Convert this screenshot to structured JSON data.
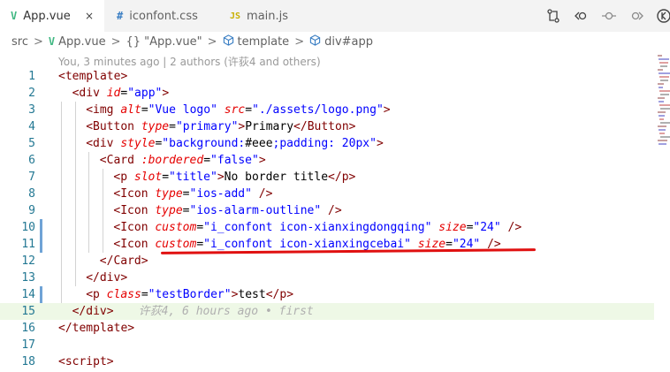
{
  "tabs": [
    {
      "icon": "V",
      "label": "App.vue",
      "active": true
    },
    {
      "icon": "#",
      "label": "iconfont.css",
      "active": false
    },
    {
      "icon": "JS",
      "label": "main.js",
      "active": false
    }
  ],
  "tab_close": "×",
  "breadcrumb": {
    "parts": [
      "src",
      "App.vue",
      "{} \"App.vue\"",
      "template",
      "div#app"
    ],
    "separator": ">"
  },
  "codelens": "You, 3 minutes ago | 2 authors (许荻4 and others)",
  "blame": "许荻4, 6 hours ago • first",
  "colors": {
    "vue_green": "#41b883",
    "css_hash": "#3b7fc4",
    "js_yellow": "#c9b000",
    "tag": "#800000",
    "attr": "#e50000",
    "string": "#0000ff",
    "annotation_red": "#e01010",
    "line_highlight": "#eef8e6"
  },
  "lines": [
    {
      "n": "1",
      "tokens": [
        [
          "pun",
          "<"
        ],
        [
          "tag",
          "template"
        ],
        [
          "pun",
          ">"
        ]
      ]
    },
    {
      "n": "2",
      "tokens": [
        [
          "pun",
          "<"
        ],
        [
          "tag",
          "div"
        ],
        [
          "txt",
          " "
        ],
        [
          "attr-i",
          "id"
        ],
        [
          "txt",
          "="
        ],
        [
          "str",
          "\"app\""
        ],
        [
          "pun",
          ">"
        ]
      ]
    },
    {
      "n": "3",
      "tokens": [
        [
          "pun",
          "<"
        ],
        [
          "tag",
          "img"
        ],
        [
          "txt",
          " "
        ],
        [
          "attr-i",
          "alt"
        ],
        [
          "txt",
          "="
        ],
        [
          "str",
          "\"Vue logo\""
        ],
        [
          "txt",
          " "
        ],
        [
          "attr-i",
          "src"
        ],
        [
          "txt",
          "="
        ],
        [
          "str",
          "\"./assets/logo.png\""
        ],
        [
          "pun",
          ">"
        ]
      ]
    },
    {
      "n": "4",
      "tokens": [
        [
          "pun",
          "<"
        ],
        [
          "tag",
          "Button"
        ],
        [
          "txt",
          " "
        ],
        [
          "attr-i",
          "type"
        ],
        [
          "txt",
          "="
        ],
        [
          "str",
          "\"primary\""
        ],
        [
          "pun",
          ">"
        ],
        [
          "txt",
          "Primary"
        ],
        [
          "pun",
          "</"
        ],
        [
          "tag",
          "Button"
        ],
        [
          "pun",
          ">"
        ]
      ]
    },
    {
      "n": "5",
      "tokens": [
        [
          "pun",
          "<"
        ],
        [
          "tag",
          "div"
        ],
        [
          "txt",
          " "
        ],
        [
          "attr-i",
          "style"
        ],
        [
          "txt",
          "="
        ],
        [
          "str",
          "\"background:"
        ],
        [
          "txt",
          "#eee"
        ],
        [
          "str",
          ";padding: 20px\""
        ],
        [
          "pun",
          ">"
        ]
      ]
    },
    {
      "n": "6",
      "tokens": [
        [
          "pun",
          "<"
        ],
        [
          "tag",
          "Card"
        ],
        [
          "txt",
          " "
        ],
        [
          "attr-i",
          ":bordered"
        ],
        [
          "txt",
          "="
        ],
        [
          "str",
          "\"false\""
        ],
        [
          "pun",
          ">"
        ]
      ]
    },
    {
      "n": "7",
      "tokens": [
        [
          "pun",
          "<"
        ],
        [
          "tag",
          "p"
        ],
        [
          "txt",
          " "
        ],
        [
          "attr-i",
          "slot"
        ],
        [
          "txt",
          "="
        ],
        [
          "str",
          "\"title\""
        ],
        [
          "pun",
          ">"
        ],
        [
          "txt",
          "No border title"
        ],
        [
          "pun",
          "</"
        ],
        [
          "tag",
          "p"
        ],
        [
          "pun",
          ">"
        ]
      ]
    },
    {
      "n": "8",
      "tokens": [
        [
          "pun",
          "<"
        ],
        [
          "tag",
          "Icon"
        ],
        [
          "txt",
          " "
        ],
        [
          "attr-i",
          "type"
        ],
        [
          "txt",
          "="
        ],
        [
          "str",
          "\"ios-add\""
        ],
        [
          "txt",
          " "
        ],
        [
          "pun",
          "/>"
        ]
      ]
    },
    {
      "n": "9",
      "tokens": [
        [
          "pun",
          "<"
        ],
        [
          "tag",
          "Icon"
        ],
        [
          "txt",
          " "
        ],
        [
          "attr-i",
          "type"
        ],
        [
          "txt",
          "="
        ],
        [
          "str",
          "\"ios-alarm-outline\""
        ],
        [
          "txt",
          " "
        ],
        [
          "pun",
          "/>"
        ]
      ]
    },
    {
      "n": "10",
      "tokens": [
        [
          "pun",
          "<"
        ],
        [
          "tag",
          "Icon"
        ],
        [
          "txt",
          " "
        ],
        [
          "attr-i",
          "custom"
        ],
        [
          "txt",
          "="
        ],
        [
          "str",
          "\"i_confont icon-xianxingdongqing\""
        ],
        [
          "txt",
          " "
        ],
        [
          "attr-i",
          "size"
        ],
        [
          "txt",
          "="
        ],
        [
          "str",
          "\"24\""
        ],
        [
          "txt",
          " "
        ],
        [
          "pun",
          "/>"
        ]
      ]
    },
    {
      "n": "11",
      "tokens": [
        [
          "pun",
          "<"
        ],
        [
          "tag",
          "Icon"
        ],
        [
          "txt",
          " "
        ],
        [
          "attr-i",
          "custom"
        ],
        [
          "txt",
          "="
        ],
        [
          "str",
          "\"i_confont icon-xianxingcebai\""
        ],
        [
          "txt",
          " "
        ],
        [
          "attr-i",
          "size"
        ],
        [
          "txt",
          "="
        ],
        [
          "str",
          "\"24\""
        ],
        [
          "txt",
          " "
        ],
        [
          "pun",
          "/>"
        ]
      ]
    },
    {
      "n": "12",
      "tokens": [
        [
          "pun",
          "</"
        ],
        [
          "tag",
          "Card"
        ],
        [
          "pun",
          ">"
        ]
      ]
    },
    {
      "n": "13",
      "tokens": [
        [
          "pun",
          "</"
        ],
        [
          "tag",
          "div"
        ],
        [
          "pun",
          ">"
        ]
      ]
    },
    {
      "n": "14",
      "tokens": [
        [
          "pun",
          "<"
        ],
        [
          "tag",
          "p"
        ],
        [
          "txt",
          " "
        ],
        [
          "attr-i",
          "class"
        ],
        [
          "txt",
          "="
        ],
        [
          "str",
          "\"testBorder\""
        ],
        [
          "pun",
          ">"
        ],
        [
          "txt",
          "test"
        ],
        [
          "pun",
          "</"
        ],
        [
          "tag",
          "p"
        ],
        [
          "pun",
          ">"
        ]
      ]
    },
    {
      "n": "15",
      "tokens": [
        [
          "pun",
          "</"
        ],
        [
          "tag",
          "div"
        ],
        [
          "pun",
          ">"
        ]
      ]
    },
    {
      "n": "16",
      "tokens": [
        [
          "pun",
          "</"
        ],
        [
          "tag",
          "template"
        ],
        [
          "pun",
          ">"
        ]
      ]
    },
    {
      "n": "17",
      "tokens": []
    },
    {
      "n": "18",
      "tokens": [
        [
          "pun",
          "<"
        ],
        [
          "tag",
          "script"
        ],
        [
          "pun",
          ">"
        ]
      ]
    }
  ],
  "icons": {
    "actions": [
      "compare-changes-icon",
      "go-back-icon",
      "commit-dot-icon",
      "go-forward-icon",
      "split-editor-icon"
    ]
  }
}
